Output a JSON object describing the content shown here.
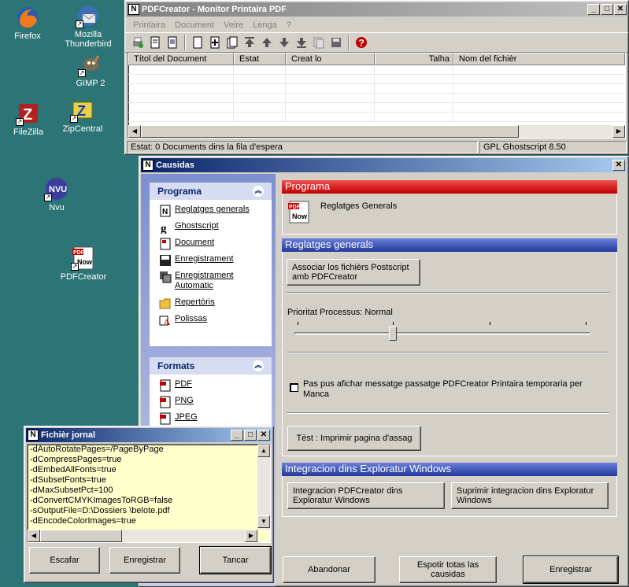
{
  "desktop": {
    "icons": [
      {
        "label": "Firefox"
      },
      {
        "label": "Mozilla Thunderbird"
      },
      {
        "label": "GIMP 2"
      },
      {
        "label": "FileZilla"
      },
      {
        "label": "ZipCentral"
      },
      {
        "label": "Nvu"
      },
      {
        "label": "PDFCreator"
      }
    ],
    "pdf_icon_text": "PDF",
    "pdf_icon_now": "Now"
  },
  "monitor": {
    "title": "PDFCreator - Monitor Printaira PDF",
    "menu": [
      "Printaira",
      "Document",
      "Veire",
      "Lenga",
      "?"
    ],
    "columns": [
      "Títol del Document",
      "Estat",
      "Creat lo",
      "Talha",
      "Nom del fichièr"
    ],
    "status_left": "Estat: 0 Documents dins la fila d'espera",
    "status_right": "GPL Ghostscript 8.50"
  },
  "options": {
    "title": "Causidas",
    "programa_panel": {
      "header": "Programa",
      "items": [
        "Reglatges generals",
        "Ghostscript",
        "Document",
        "Enregistrament",
        "Enregistrament Automatic",
        "Repertòris",
        "Polissas"
      ]
    },
    "formats_panel": {
      "header": "Formats",
      "items": [
        "PDF",
        "PNG",
        "JPEG"
      ]
    },
    "programa_header": "Programa",
    "programa_subtitle": "Reglatges Generals",
    "reglatges_header": "Reglatges generals",
    "associate_button": "Associar los fichièrs Postscript amb PDFCreator",
    "priority_label": "Prioritat Processus: Normal",
    "priority_value": 0.33,
    "checkbox_label": "Pas pus afichar messatge  passatge PDFCreator Printaira temporaria per Manca",
    "checkbox_checked": false,
    "test_button": "Tèst : Imprimir pagina d'assag",
    "integration_header": "Integracion dins Exploratur Windows",
    "integrate_button": "Integracion PDFCreator dins Exploratur Windows",
    "remove_integration_button": "Suprimir integracion dins Exploratur Windows",
    "cancel_button": "Abandonar",
    "restore_defaults_button": "Espotir totas las causidas",
    "save_button": "Enregistrar"
  },
  "log": {
    "title": "Fichièr jornal",
    "lines": [
      "-dAutoRotatePages=/PageByPage",
      "-dCompressPages=true",
      "-dEmbedAllFonts=true",
      "-dSubsetFonts=true",
      "-dMaxSubsetPct=100",
      "-dConvertCMYKImagesToRGB=false",
      "-sOutputFile=D:\\Dossiers \\belote.pdf",
      "-dEncodeColorImages=true"
    ],
    "clear_button": "Escafar",
    "save_button": "Enregistrar",
    "close_button": "Tancar"
  },
  "colors": {
    "desktop": "#2d7476",
    "header_red": "#c00000",
    "header_blue": "#233a9c",
    "log_background": "#ffffcc"
  }
}
